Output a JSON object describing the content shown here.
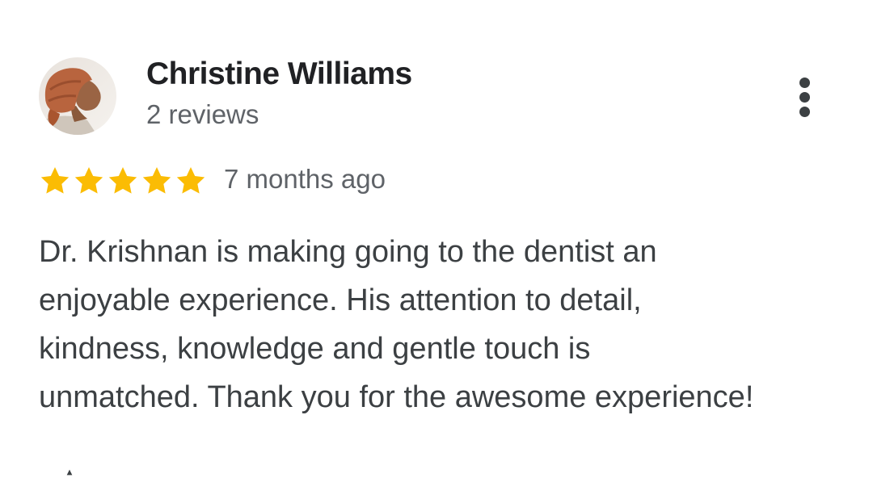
{
  "reviewer": {
    "name": "Christine Williams",
    "review_count": "2 reviews",
    "avatar_icon": "profile-photo"
  },
  "rating": {
    "stars": 5,
    "max_stars": 5,
    "star_color": "#fbbc04",
    "date": "7 months ago"
  },
  "review": {
    "lines": [
      "Dr. Krishnan is making going to the dentist an",
      "enjoyable experience. His attention to detail,",
      "kindness, knowledge and gentle touch is",
      "unmatched. Thank you for the awesome experience!"
    ]
  },
  "menu": {
    "icon": "more-vert-icon"
  },
  "footer": {
    "icon": "thumb-up-icon"
  }
}
